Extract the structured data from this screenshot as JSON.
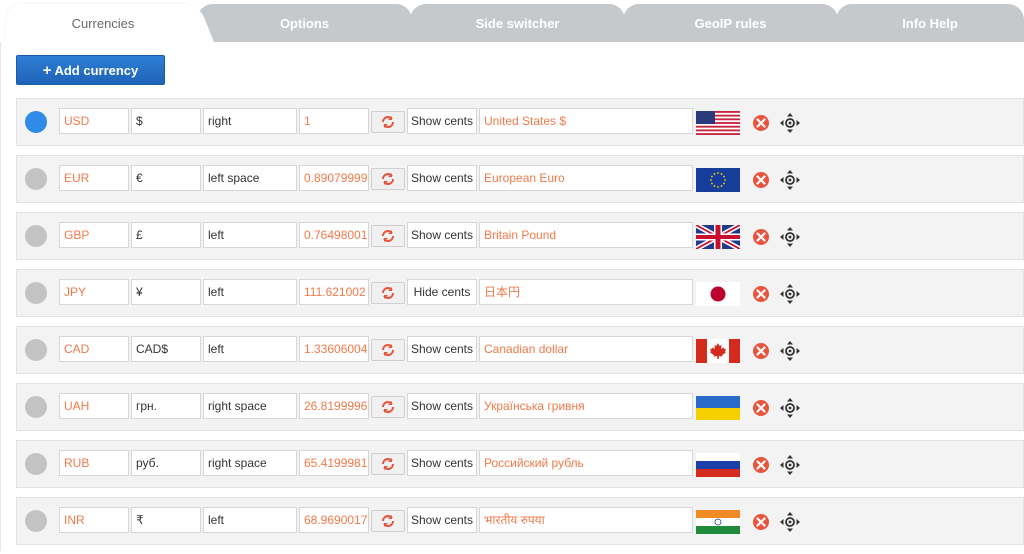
{
  "tabs": [
    {
      "label": "Currencies",
      "active": true
    },
    {
      "label": "Options",
      "active": false
    },
    {
      "label": "Side switcher",
      "active": false
    },
    {
      "label": "GeoIP rules",
      "active": false
    },
    {
      "label": "Info Help",
      "active": false
    }
  ],
  "add_button": {
    "label": "Add currency"
  },
  "currencies": [
    {
      "code": "USD",
      "symbol": "$",
      "position": "right",
      "rate": "1",
      "cents": "Show cents",
      "name": "United States $",
      "flag": "us-flag",
      "default": true
    },
    {
      "code": "EUR",
      "symbol": "€",
      "position": "left space",
      "rate": "0.89079999",
      "cents": "Show cents",
      "name": "European Euro",
      "flag": "eu-flag",
      "default": false
    },
    {
      "code": "GBP",
      "symbol": "£",
      "position": "left",
      "rate": "0.76498001",
      "cents": "Show cents",
      "name": "Britain Pound",
      "flag": "gb-flag",
      "default": false
    },
    {
      "code": "JPY",
      "symbol": "¥",
      "position": "left",
      "rate": "111.621002",
      "cents": "Hide cents",
      "name": "日本円",
      "flag": "jp-flag",
      "default": false
    },
    {
      "code": "CAD",
      "symbol": "CAD$",
      "position": "left",
      "rate": "1.33606004",
      "cents": "Show cents",
      "name": "Canadian dollar",
      "flag": "ca-flag",
      "default": false
    },
    {
      "code": "UAH",
      "symbol": "грн.",
      "position": "right space",
      "rate": "26.8199996",
      "cents": "Show cents",
      "name": "Українська гривня",
      "flag": "ua-flag",
      "default": false
    },
    {
      "code": "RUB",
      "symbol": "руб.",
      "position": "right space",
      "rate": "65.4199981",
      "cents": "Show cents",
      "name": "Российский рубль",
      "flag": "ru-flag",
      "default": false
    },
    {
      "code": "INR",
      "symbol": "₹",
      "position": "left",
      "rate": "68.9690017",
      "cents": "Show cents",
      "name": "भारतीय रुपया",
      "flag": "in-flag",
      "default": false
    }
  ],
  "colors": {
    "accent_blue": "#1e63b8",
    "value_orange": "#f07a4a",
    "radio_selected": "#2f8ae8",
    "delete_red": "#e8553e"
  }
}
